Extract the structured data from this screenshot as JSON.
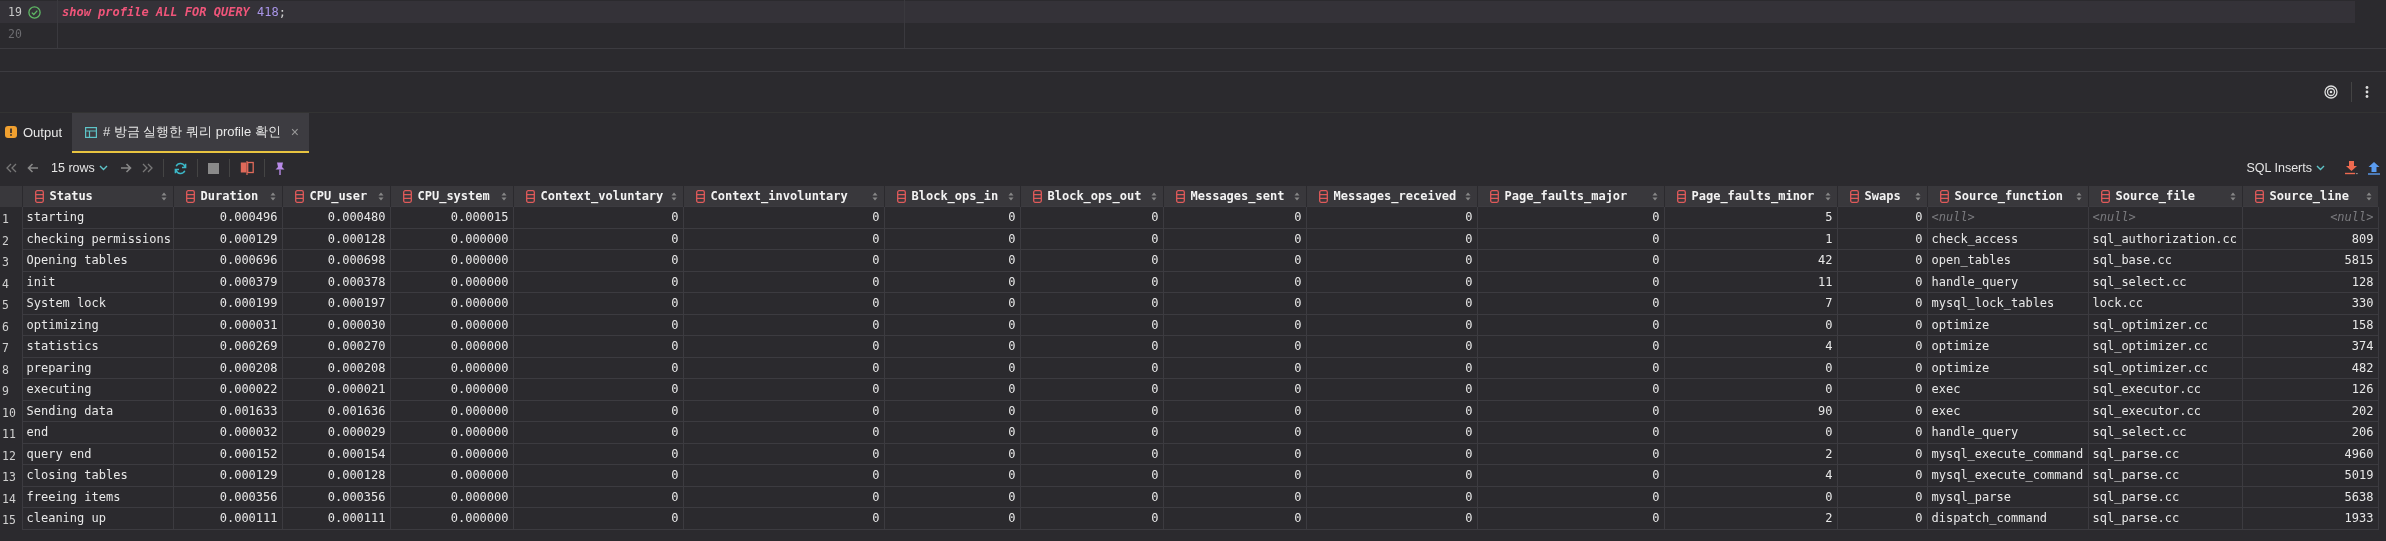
{
  "editor": {
    "lines": [
      {
        "number": "19",
        "executed": true,
        "current": true,
        "tokens": [
          {
            "kind": "keyword",
            "text": "show profile ALL FOR QUERY"
          },
          {
            "kind": "number",
            "text": "418"
          },
          {
            "kind": "plain",
            "text": ";"
          }
        ]
      },
      {
        "number": "20",
        "executed": false,
        "current": false
      }
    ]
  },
  "tabs": [
    {
      "kind": "output",
      "label": "Output",
      "selected": false
    },
    {
      "kind": "result",
      "label": "# 방금 실행한 쿼리 profile 확인",
      "selected": true,
      "close": "×"
    }
  ],
  "toolbar": {
    "row_count": "15 rows",
    "export_format": "SQL Inserts"
  },
  "table": {
    "columns": [
      {
        "name": "Status",
        "kind": "text"
      },
      {
        "name": "Duration",
        "kind": "numeric"
      },
      {
        "name": "CPU_user",
        "kind": "numeric"
      },
      {
        "name": "CPU_system",
        "kind": "numeric"
      },
      {
        "name": "Context_voluntary",
        "kind": "numeric"
      },
      {
        "name": "Context_involuntary",
        "kind": "numeric"
      },
      {
        "name": "Block_ops_in",
        "kind": "numeric"
      },
      {
        "name": "Block_ops_out",
        "kind": "numeric"
      },
      {
        "name": "Messages_sent",
        "kind": "numeric"
      },
      {
        "name": "Messages_received",
        "kind": "numeric"
      },
      {
        "name": "Page_faults_major",
        "kind": "numeric"
      },
      {
        "name": "Page_faults_minor",
        "kind": "numeric"
      },
      {
        "name": "Swaps",
        "kind": "numeric"
      },
      {
        "name": "Source_function",
        "kind": "text"
      },
      {
        "name": "Source_file",
        "kind": "text"
      },
      {
        "name": "Source_line",
        "kind": "numeric"
      }
    ],
    "rows": [
      {
        "number": "1",
        "cells": [
          "starting",
          "0.000496",
          "0.000480",
          "0.000015",
          "0",
          "0",
          "0",
          "0",
          "0",
          "0",
          "0",
          "5",
          "0",
          {
            "text": "<null>",
            "null": true
          },
          {
            "text": "<null>",
            "null": true
          },
          {
            "text": "<null>",
            "null": true
          }
        ]
      },
      {
        "number": "2",
        "cells": [
          "checking permissions",
          "0.000129",
          "0.000128",
          "0.000000",
          "0",
          "0",
          "0",
          "0",
          "0",
          "0",
          "0",
          "1",
          "0",
          "check_access",
          "sql_authorization.cc",
          "809"
        ]
      },
      {
        "number": "3",
        "cells": [
          "Opening tables",
          "0.000696",
          "0.000698",
          "0.000000",
          "0",
          "0",
          "0",
          "0",
          "0",
          "0",
          "0",
          "42",
          "0",
          "open_tables",
          "sql_base.cc",
          "5815"
        ]
      },
      {
        "number": "4",
        "cells": [
          "init",
          "0.000379",
          "0.000378",
          "0.000000",
          "0",
          "0",
          "0",
          "0",
          "0",
          "0",
          "0",
          "11",
          "0",
          "handle_query",
          "sql_select.cc",
          "128"
        ]
      },
      {
        "number": "5",
        "cells": [
          "System lock",
          "0.000199",
          "0.000197",
          "0.000000",
          "0",
          "0",
          "0",
          "0",
          "0",
          "0",
          "0",
          "7",
          "0",
          "mysql_lock_tables",
          "lock.cc",
          "330"
        ]
      },
      {
        "number": "6",
        "cells": [
          "optimizing",
          "0.000031",
          "0.000030",
          "0.000000",
          "0",
          "0",
          "0",
          "0",
          "0",
          "0",
          "0",
          "0",
          "0",
          "optimize",
          "sql_optimizer.cc",
          "158"
        ]
      },
      {
        "number": "7",
        "cells": [
          "statistics",
          "0.000269",
          "0.000270",
          "0.000000",
          "0",
          "0",
          "0",
          "0",
          "0",
          "0",
          "0",
          "4",
          "0",
          "optimize",
          "sql_optimizer.cc",
          "374"
        ]
      },
      {
        "number": "8",
        "cells": [
          "preparing",
          "0.000208",
          "0.000208",
          "0.000000",
          "0",
          "0",
          "0",
          "0",
          "0",
          "0",
          "0",
          "0",
          "0",
          "optimize",
          "sql_optimizer.cc",
          "482"
        ]
      },
      {
        "number": "9",
        "cells": [
          "executing",
          "0.000022",
          "0.000021",
          "0.000000",
          "0",
          "0",
          "0",
          "0",
          "0",
          "0",
          "0",
          "0",
          "0",
          "exec",
          "sql_executor.cc",
          "126"
        ]
      },
      {
        "number": "10",
        "cells": [
          "Sending data",
          "0.001633",
          "0.001636",
          "0.000000",
          "0",
          "0",
          "0",
          "0",
          "0",
          "0",
          "0",
          "90",
          "0",
          "exec",
          "sql_executor.cc",
          "202"
        ]
      },
      {
        "number": "11",
        "cells": [
          "end",
          "0.000032",
          "0.000029",
          "0.000000",
          "0",
          "0",
          "0",
          "0",
          "0",
          "0",
          "0",
          "0",
          "0",
          "handle_query",
          "sql_select.cc",
          "206"
        ]
      },
      {
        "number": "12",
        "cells": [
          "query end",
          "0.000152",
          "0.000154",
          "0.000000",
          "0",
          "0",
          "0",
          "0",
          "0",
          "0",
          "0",
          "2",
          "0",
          "mysql_execute_command",
          "sql_parse.cc",
          "4960"
        ]
      },
      {
        "number": "13",
        "cells": [
          "closing tables",
          "0.000129",
          "0.000128",
          "0.000000",
          "0",
          "0",
          "0",
          "0",
          "0",
          "0",
          "0",
          "4",
          "0",
          "mysql_execute_command",
          "sql_parse.cc",
          "5019"
        ]
      },
      {
        "number": "14",
        "cells": [
          "freeing items",
          "0.000356",
          "0.000356",
          "0.000000",
          "0",
          "0",
          "0",
          "0",
          "0",
          "0",
          "0",
          "0",
          "0",
          "mysql_parse",
          "sql_parse.cc",
          "5638"
        ]
      },
      {
        "number": "15",
        "cells": [
          "cleaning up",
          "0.000111",
          "0.000111",
          "0.000000",
          "0",
          "0",
          "0",
          "0",
          "0",
          "0",
          "0",
          "2",
          "0",
          "dispatch_command",
          "sql_parse.cc",
          "1933"
        ]
      }
    ]
  }
}
